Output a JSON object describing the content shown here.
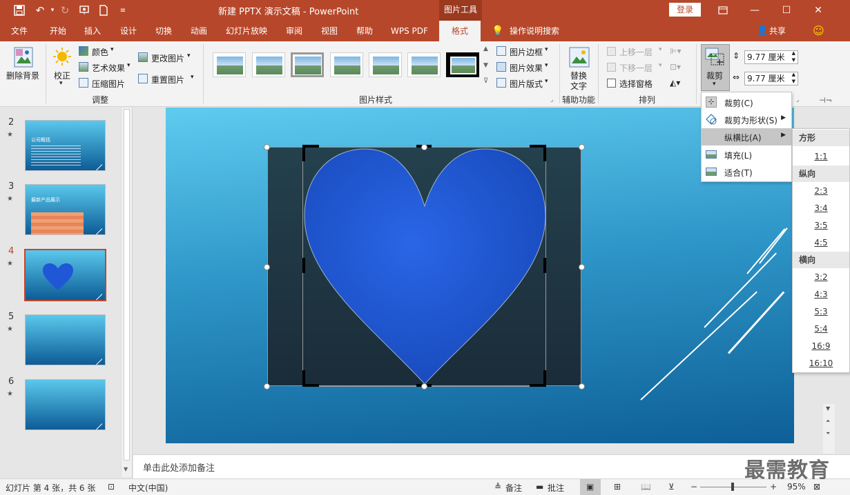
{
  "titlebar": {
    "title": "新建 PPTX 演示文稿 - PowerPoint",
    "context_tool": "图片工具",
    "login": "登录"
  },
  "tabs": [
    "文件",
    "开始",
    "插入",
    "设计",
    "切换",
    "动画",
    "幻灯片放映",
    "审阅",
    "视图",
    "帮助",
    "WPS PDF",
    "格式"
  ],
  "tell_me": "操作说明搜索",
  "share": "共享",
  "ribbon": {
    "remove_bg": "删除背景",
    "correct": "校正",
    "color": "颜色",
    "art_effects": "艺术效果",
    "compress": "压缩图片",
    "change_pic": "更改图片",
    "reset_pic": "重置图片",
    "group_adjust": "调整",
    "pic_border": "图片边框",
    "pic_effects": "图片效果",
    "pic_layout": "图片版式",
    "group_styles": "图片样式",
    "alt_text": "替换文字",
    "alt_text_line1": "替换",
    "alt_text_line2": "文字",
    "group_access": "辅助功能",
    "bring_forward": "上移一层",
    "send_backward": "下移一层",
    "selection_pane": "选择窗格",
    "group_arrange": "排列",
    "crop": "裁剪",
    "height": "9.77 厘米",
    "width": "9.77 厘米"
  },
  "crop_menu": {
    "items": [
      "裁剪(C)",
      "裁剪为形状(S)",
      "纵横比(A)",
      "填充(L)",
      "适合(T)"
    ]
  },
  "aspect_menu": {
    "square_header": "方形",
    "square": [
      "1:1"
    ],
    "portrait_header": "纵向",
    "portrait": [
      "2:3",
      "3:4",
      "3:5",
      "4:5"
    ],
    "landscape_header": "横向",
    "landscape": [
      "3:2",
      "4:3",
      "5:3",
      "5:4",
      "16:9",
      "16:10"
    ]
  },
  "slides": [
    {
      "num": "2",
      "title": "公司概括"
    },
    {
      "num": "3",
      "title": "最新产品展示"
    },
    {
      "num": "4",
      "title": ""
    },
    {
      "num": "5",
      "title": ""
    },
    {
      "num": "6",
      "title": ""
    }
  ],
  "notes_placeholder": "单击此处添加备注",
  "status": {
    "slide_info": "幻灯片 第 4 张，共 6 张",
    "language": "中文(中国)",
    "notes": "备注",
    "comments": "批注",
    "zoom": "95%"
  },
  "watermark": "最需教育",
  "colors": {
    "accent": "#b7472a",
    "heart": "#1f57d6",
    "slide_top": "#5fcbef",
    "slide_bottom": "#0d5f97"
  }
}
